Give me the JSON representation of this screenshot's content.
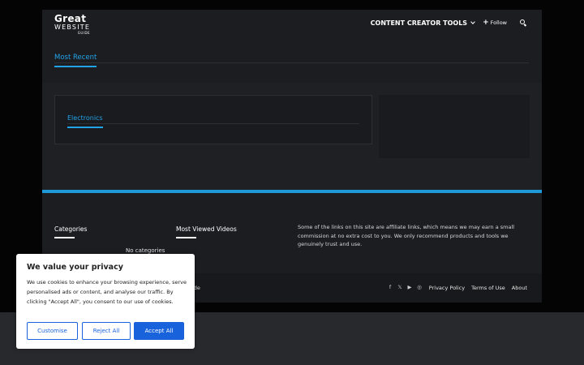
{
  "logo": {
    "line1": "Great",
    "line2": "WEBSITE",
    "line3": "GUIDE"
  },
  "nav": {
    "tools_label": "CONTENT CREATOR TOOLS",
    "follow_plus": "+",
    "follow_label": "Follow"
  },
  "tabs": {
    "active": "Most Recent"
  },
  "electronics": {
    "title": "Electronics"
  },
  "footer": {
    "categories_title": "Categories",
    "no_categories": "No categories",
    "videos_title": "Most Viewed Videos",
    "affiliate_text": "Some of the links on this site are affiliate links, which means we may earn a small commission at no extra cost to you. We only recommend products and tools we genuinely trust and use.",
    "copyright": "site Guide",
    "social": {
      "facebook": "f",
      "x": "𝕏",
      "youtube": "▶",
      "instagram": "◎"
    },
    "links": [
      "Privacy Policy",
      "Terms of Use",
      "About"
    ]
  },
  "cookie": {
    "title": "We value your privacy",
    "text": "We use cookies to enhance your browsing experience, serve personalised ads or content, and analyse our traffic. By clicking \"Accept All\", you consent to our use of cookies.",
    "customise": "Customise",
    "reject": "Reject All",
    "accept": "Accept All"
  },
  "colors": {
    "accent": "#22a3e8",
    "footer_bar": "#1e9ad8",
    "cookie_button": "#1863dc"
  }
}
